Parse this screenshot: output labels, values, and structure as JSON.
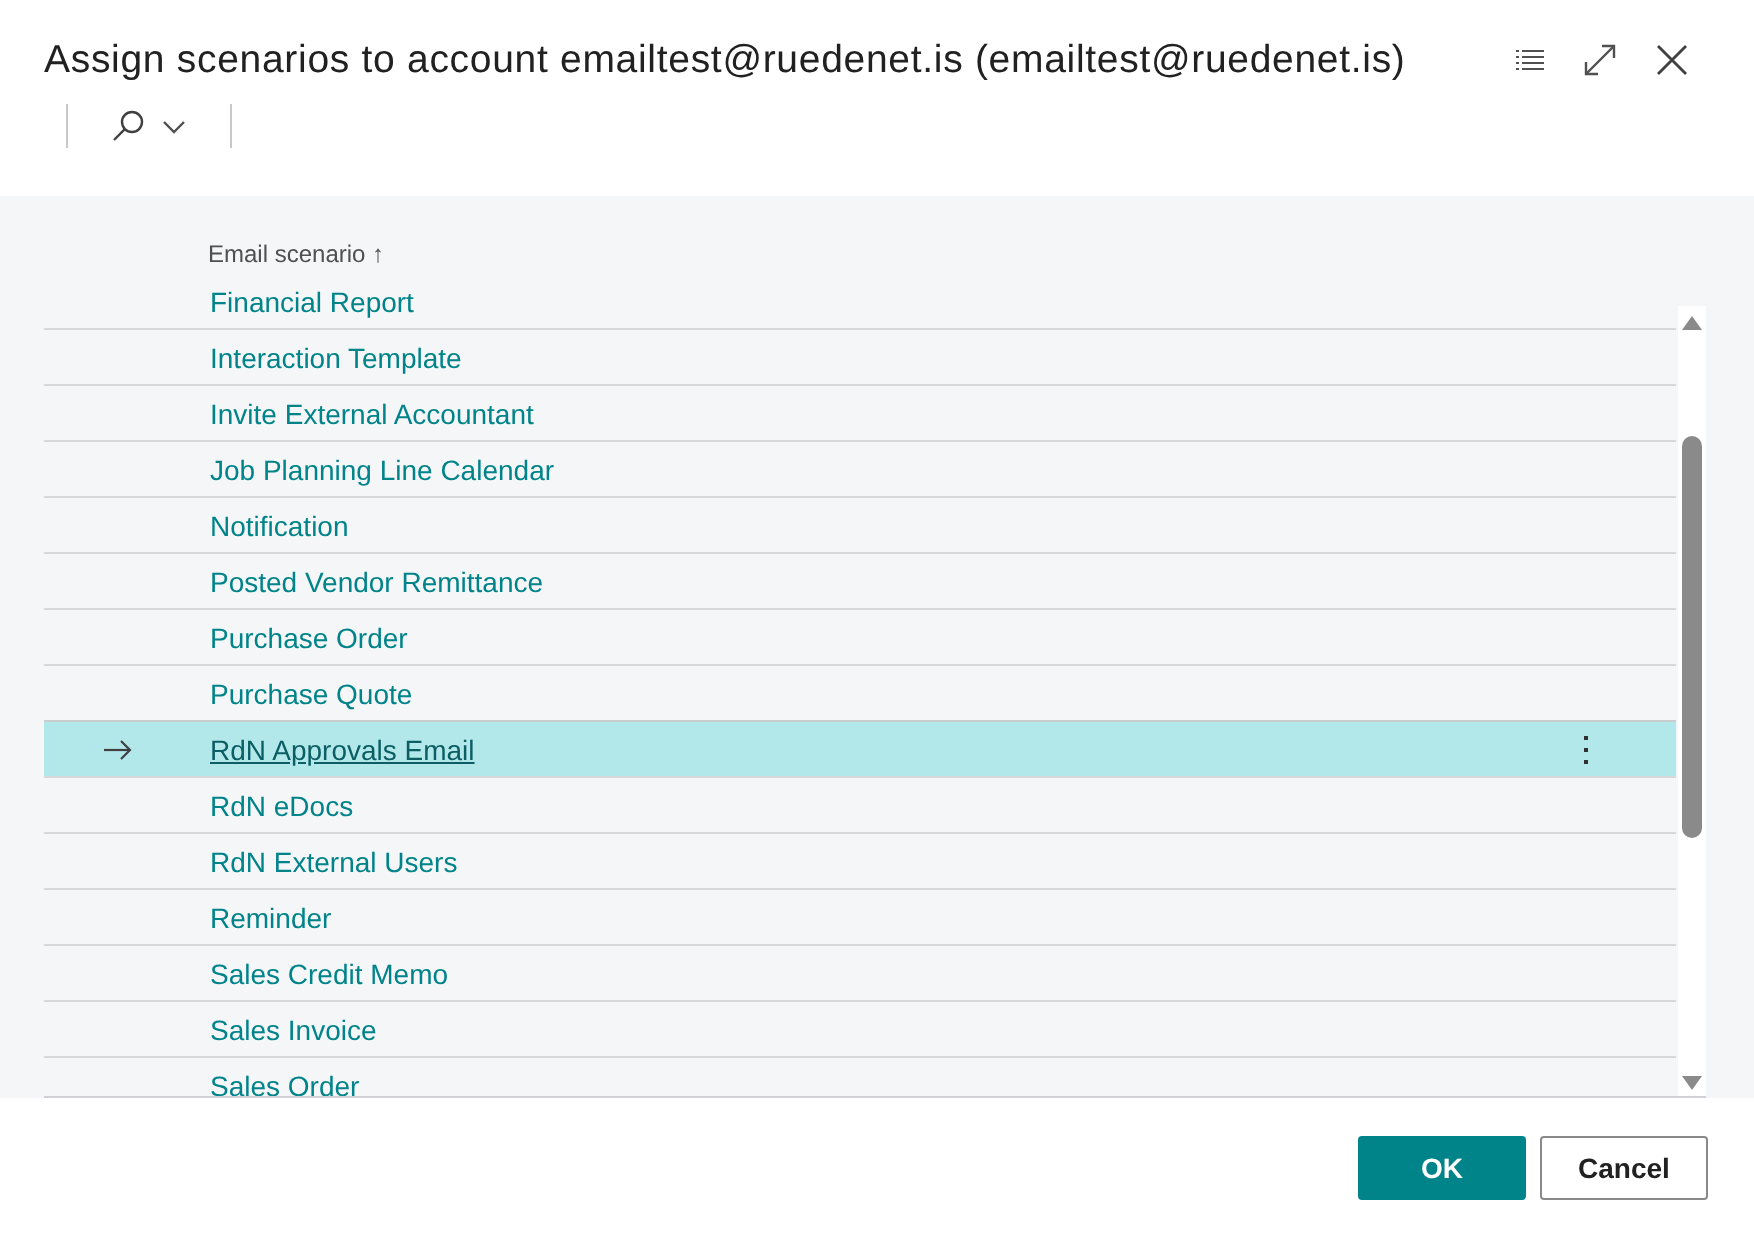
{
  "window": {
    "title": "Assign scenarios to account emailtest@ruedenet.is (emailtest@ruedenet.is)"
  },
  "table": {
    "columns": [
      {
        "label": "Email scenario ↑"
      }
    ],
    "rows": [
      {
        "email_scenario": "Financial Report",
        "selected": false
      },
      {
        "email_scenario": "Interaction Template",
        "selected": false
      },
      {
        "email_scenario": "Invite External Accountant",
        "selected": false
      },
      {
        "email_scenario": "Job Planning Line Calendar",
        "selected": false
      },
      {
        "email_scenario": "Notification",
        "selected": false
      },
      {
        "email_scenario": "Posted Vendor Remittance",
        "selected": false
      },
      {
        "email_scenario": "Purchase Order",
        "selected": false
      },
      {
        "email_scenario": "Purchase Quote",
        "selected": false
      },
      {
        "email_scenario": "RdN Approvals Email",
        "selected": true
      },
      {
        "email_scenario": "RdN eDocs",
        "selected": false
      },
      {
        "email_scenario": "RdN External Users",
        "selected": false
      },
      {
        "email_scenario": "Reminder",
        "selected": false
      },
      {
        "email_scenario": "Sales Credit Memo",
        "selected": false
      },
      {
        "email_scenario": "Sales Invoice",
        "selected": false
      },
      {
        "email_scenario": "Sales Order",
        "selected": false
      }
    ]
  },
  "buttons": [
    {
      "label": "OK",
      "kind": "primary"
    },
    {
      "label": "Cancel",
      "kind": "secondary"
    }
  ]
}
